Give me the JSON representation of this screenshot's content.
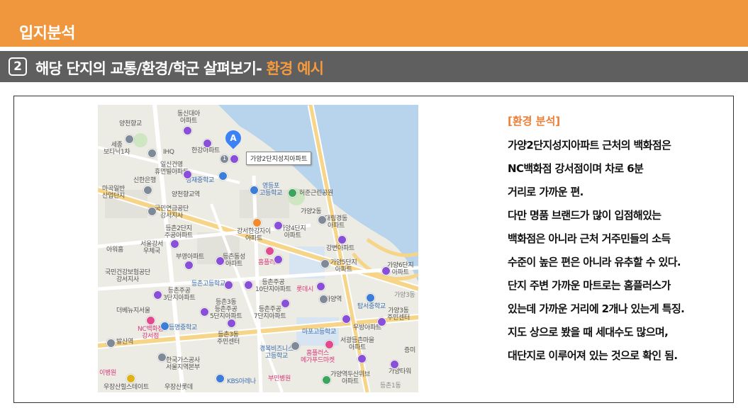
{
  "header": {
    "title": "입지분석"
  },
  "section": {
    "number": "2",
    "heading": "해당 단지의 교통/환경/학군 살펴보기-",
    "accent": "환경 예시"
  },
  "map": {
    "marker_letter": "A",
    "marker_count": "1",
    "callout": "가양2단지성지아파트",
    "labels": [
      "동신대아\n아파트",
      "양천향교",
      "세종\n보타닉1차",
      "IHQ",
      "한강아파트",
      "일신건영\n휴먼빌아파트",
      "성재중학교",
      "신한은행",
      "마곡일반\n산업단지",
      "양천향교역",
      "영등포\n고등학교",
      "허준근린공원",
      "국민연금공단\n강서지사",
      "가양2동",
      "대림경동\n아파트",
      "등촌2단지\n주공아파트",
      "강서한강자이\n아파트",
      "가양4단지\n아파트",
      "강변아파트",
      "서울강서\n우체국",
      "아워홈",
      "부영아파트",
      "등촌동성\n아파트",
      "홈플러스",
      "가양5단지\n아파트",
      "가양6단지\n아파트",
      "국민건강보험공단\n강서지사",
      "등촌고등학교",
      "등촌주공\n10단지아파트",
      "롯데시",
      "가양역",
      "가양3동",
      "등촌주공\n3단지아파트",
      "더베뉴지서울",
      "등촌3동\n등촌주공\n5단지아파트",
      "등촌주공\n7단지아파트",
      "탑서중학교",
      "가양3동\n주민센터",
      "NC백화점\n강서점",
      "등명중학교",
      "등촌3동\n주민센터",
      "마포고등학교",
      "우방아파트",
      "발산역",
      "서광등촌마을\n아파트",
      "경복비즈니스\n고등학교",
      "홈플러스\n메가푸드마켓",
      "증미",
      "한국가스공사\n서울지역본부",
      "가양역두산위브\n아파트",
      "가양타워",
      "우장산힐스테이트",
      "우장산롯데",
      "KBS아레나",
      "부민병원",
      "등촌1동",
      "이병원"
    ]
  },
  "panel": {
    "title": "[환경 분석]",
    "lines": [
      "가양2단지성지아파트 근처의 백화점은",
      "NC백화점 강서점이며 차로 6분",
      "거리로 가까운 편.",
      "다만 명품 브랜드가 많이 입점해있는",
      "백화점은 아니라 근처 거주민들의 소득",
      "수준이 높은 편은 아니라 유추할 수 있다.",
      "단지 주변 가까운 마트로는 홈플러스가",
      "있는데 가까운 거리에 2개나 있는게 특징.",
      "지도 상으로 봤을 때 세대수도 많으며,",
      "대단지로 이루어져 있는 것으로 확인 됨."
    ]
  },
  "colors": {
    "header_bar": "#f0963c",
    "section_bar": "#5f5f5f",
    "accent": "#ee7d33",
    "river": "#b7d4ec",
    "apartment_pin": "#8a4fd8",
    "mart_pin": "#e34a8e"
  }
}
